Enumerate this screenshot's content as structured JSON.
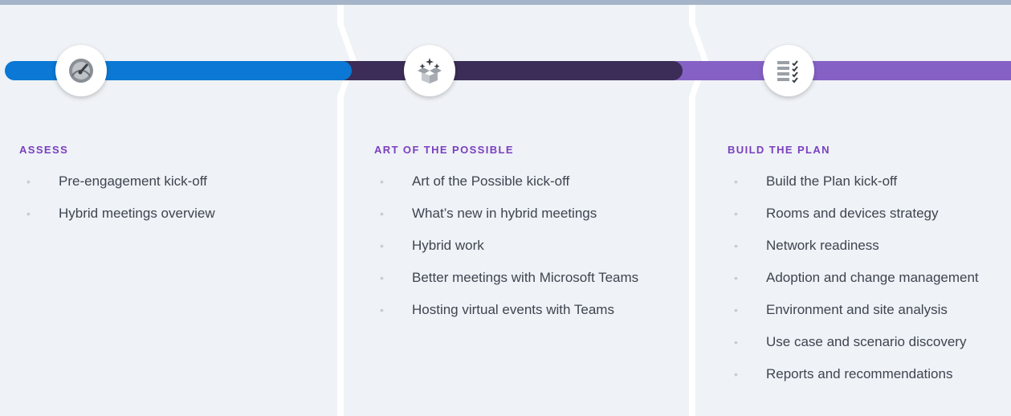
{
  "colors": {
    "background": "#eff2f6",
    "top_bar": "#a5b4c8",
    "assess": "#0a78d4",
    "art_of_the_possible": "#3b2d57",
    "build_the_plan": "#8661c5",
    "heading": "#7a3fc0",
    "bullet": "#c9cbd4"
  },
  "phases": [
    {
      "icon": "speedometer-icon",
      "heading": "ASSESS",
      "items": [
        "Pre-engagement kick-off",
        "Hybrid meetings overview"
      ]
    },
    {
      "icon": "sparkle-box-icon",
      "heading": "ART OF THE POSSIBLE",
      "items": [
        "Art of the Possible kick-off",
        "What’s new in hybrid meetings",
        "Hybrid work",
        "Better meetings with Microsoft Teams",
        "Hosting virtual events with Teams"
      ]
    },
    {
      "icon": "checklist-icon",
      "heading": "BUILD THE PLAN",
      "items": [
        "Build the Plan kick-off",
        "Rooms and devices strategy",
        "Network readiness",
        "Adoption and change management",
        "Environment and site analysis",
        "Use case and scenario discovery",
        "Reports and recommendations"
      ]
    }
  ]
}
